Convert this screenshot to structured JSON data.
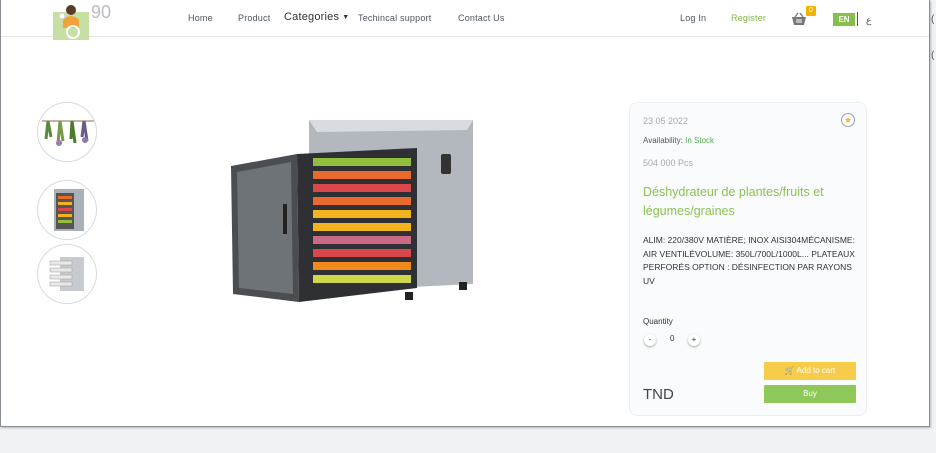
{
  "logo": {
    "number": "90"
  },
  "nav": {
    "home": "Home",
    "product": "Product",
    "categories": "Categories",
    "support": "Techincal support",
    "contact": "Contact Us",
    "login": "Log In",
    "register": "Register",
    "cart_count": "0",
    "lang_active": "EN",
    "lang_alt": "ع"
  },
  "edge": {
    "mark1": "(",
    "mark2": "("
  },
  "product": {
    "date": "23 05 2022",
    "availability_label": "Availability:",
    "availability_value": "In Stock",
    "pieces": "504 000 Pcs",
    "title": "Déshydrateur de plantes/fruits et légumes/graines",
    "description": "ALIM: 220/380V MATIÈRE; INOX AISI304MÉCANISME: AIR VENTILÉVOLUME: 350L/700L/1000L... PLATEAUX PERFORÉS OPTION : DÉSINFECTION PAR RAYONS UV",
    "quantity_label": "Quantity",
    "quantity_value": "0",
    "minus": "-",
    "plus": "+",
    "add_to_cart": "Add to cart",
    "buy": "Buy",
    "currency": "TND"
  },
  "colors": {
    "accent_green": "#8cc152",
    "accent_yellow": "#f7cc4a",
    "lang_green": "#86bf4a"
  }
}
